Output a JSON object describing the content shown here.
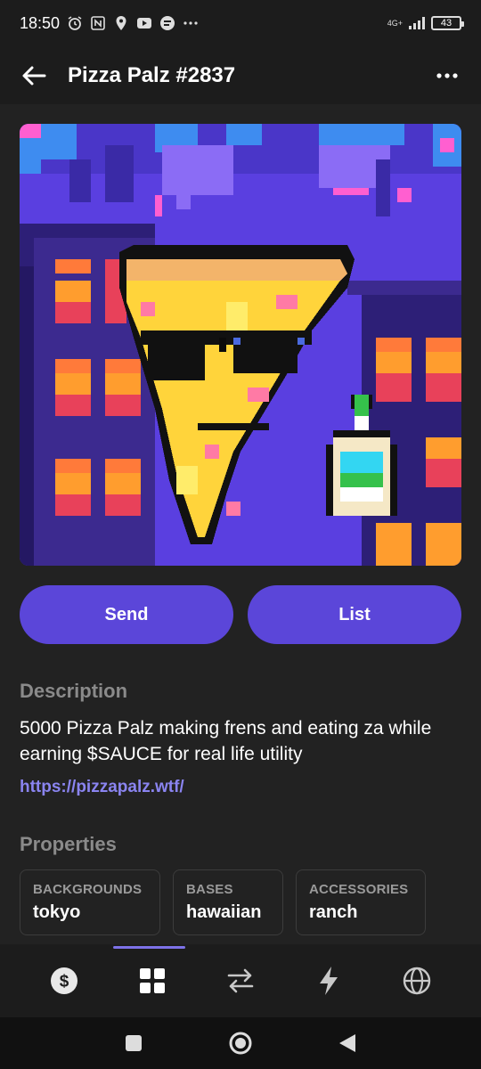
{
  "status_bar": {
    "time": "18:50",
    "network": "4G+",
    "battery": "43",
    "icons": [
      "alarm-icon",
      "nfc-icon",
      "location-icon",
      "youtube-icon",
      "chat-icon",
      "more-dots-icon"
    ]
  },
  "header": {
    "title": "Pizza Palz #2837",
    "back_icon": "arrow-left-icon",
    "more_icon": "more-horizontal-icon"
  },
  "actions": {
    "send_label": "Send",
    "list_label": "List"
  },
  "description": {
    "label": "Description",
    "text": "5000 Pizza Palz making frens and eating za while earning $SAUCE for real life utility",
    "link": "https://pizzapalz.wtf/"
  },
  "properties": {
    "label": "Properties",
    "items": [
      {
        "type": "BACKGROUNDS",
        "value": "tokyo"
      },
      {
        "type": "BASES",
        "value": "hawaiian"
      },
      {
        "type": "ACCESSORIES",
        "value": "ranch"
      }
    ]
  },
  "bottom_nav": {
    "items": [
      "dollar-icon",
      "grid-icon",
      "swap-icon",
      "lightning-icon",
      "globe-icon"
    ],
    "active": "grid-icon"
  },
  "colors": {
    "accent": "#5b46d9",
    "link": "#8a84f0",
    "background": "#222222"
  }
}
